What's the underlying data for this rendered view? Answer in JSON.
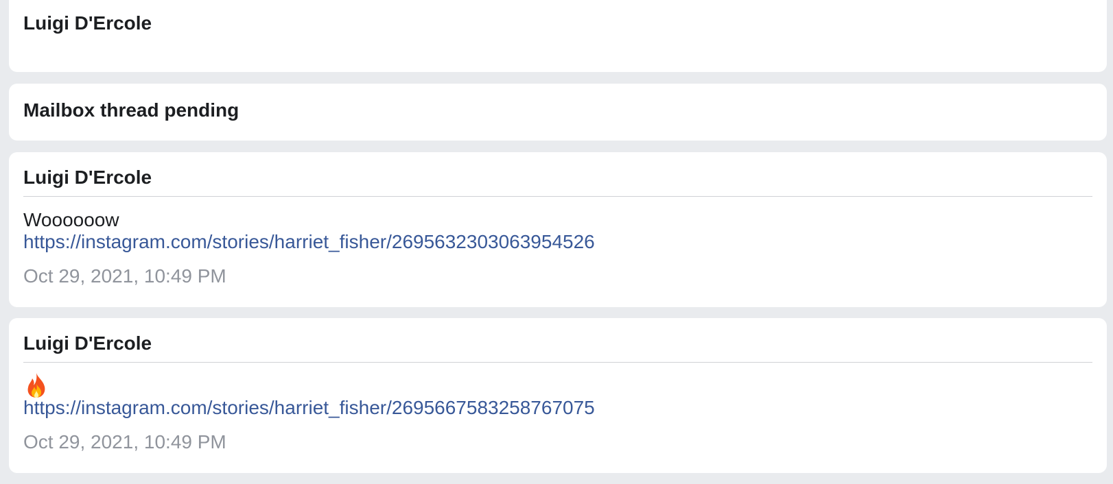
{
  "thread_header": {
    "sender": "Luigi D'Ercole"
  },
  "status_card": {
    "text": "Mailbox thread pending"
  },
  "messages": [
    {
      "sender": "Luigi D'Ercole",
      "text": "Woooooow",
      "link": "https://instagram.com/stories/harriet_fisher/2695632303063954526",
      "timestamp": "Oct 29, 2021, 10:49 PM"
    },
    {
      "sender": "Luigi D'Ercole",
      "emoji": "fire-icon",
      "link": "https://instagram.com/stories/harriet_fisher/2695667583258767075",
      "timestamp": "Oct 29, 2021, 10:49 PM"
    }
  ],
  "colors": {
    "background": "#e9ebee",
    "card": "#ffffff",
    "text": "#1c1e21",
    "link": "#385898",
    "timestamp": "#90949c",
    "divider": "#cfd1d5"
  }
}
